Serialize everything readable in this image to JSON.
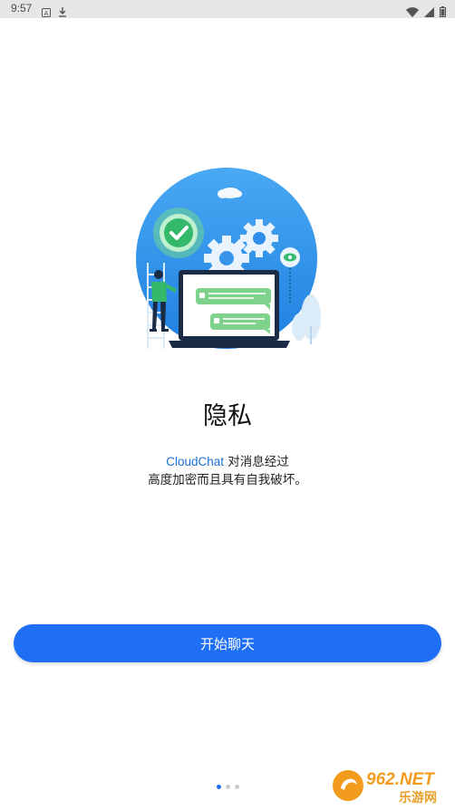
{
  "status_bar": {
    "time": "9:57"
  },
  "content": {
    "title": "隐私",
    "description_brand": "CloudChat",
    "description_line1": " 对消息经过",
    "description_line2": "高度加密而且具有自我破坏。"
  },
  "actions": {
    "start_label": "开始聊天"
  },
  "pagination": {
    "count": 3,
    "active": 0
  },
  "watermark": {
    "text_top": "962.NET",
    "text_bottom": "乐游网"
  },
  "colors": {
    "accent": "#1f6ef6",
    "brand_text": "#1a6fd1",
    "circle": "#2f8fea",
    "chat_green": "#7fd28c"
  }
}
